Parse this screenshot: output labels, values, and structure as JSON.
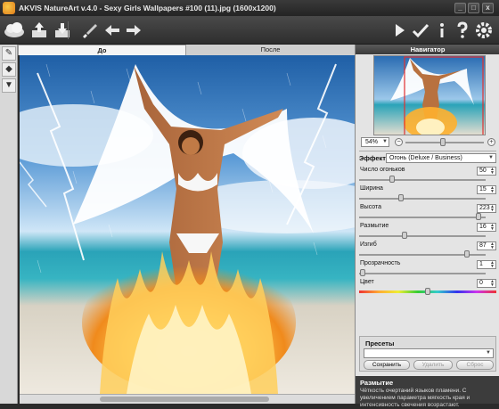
{
  "window": {
    "title": "AKVIS NatureArt v.4.0 - Sexy Girls Wallpapers #100 (11).jpg (1600x1200)",
    "minimize": "_",
    "maximize": "□",
    "close": "x"
  },
  "toolbar": {
    "icons": [
      "cloud-logo-icon",
      "open-file-icon",
      "save-file-icon",
      "brush-icon",
      "undo-icon",
      "redo-icon",
      "run-icon",
      "apply-icon",
      "info-icon",
      "help-icon",
      "settings-icon"
    ]
  },
  "tabs": {
    "before": "До",
    "after": "После"
  },
  "navigator": {
    "title": "Навигатор",
    "zoom": "54%",
    "zoom_out": "−",
    "zoom_in": "+",
    "zoom_level": 0.48
  },
  "effect": {
    "label": "Эффект:",
    "value": "Огонь (Deluxe / Business)"
  },
  "params": [
    {
      "label": "Число огоньков",
      "value": "50",
      "level": 0.25
    },
    {
      "label": "Ширина",
      "value": "15",
      "level": 0.32
    },
    {
      "label": "Высота",
      "value": "223",
      "level": 0.96
    },
    {
      "label": "Размытие",
      "value": "16",
      "level": 0.35
    },
    {
      "label": "Изгиб",
      "value": "87",
      "level": 0.87
    },
    {
      "label": "Прозрачность",
      "value": "1",
      "level": 0.01
    },
    {
      "label": "Цвет",
      "value": "0",
      "level": 0.5
    }
  ],
  "presets": {
    "title": "Пресеты",
    "value": "",
    "save": "Сохранить",
    "delete": "Удалить",
    "reset": "Сброс"
  },
  "help": {
    "title": "Размытие",
    "text": "Чёткость очертаний языков пламени. С увеличением параметра мягкость края и интенсивность свечения возрастают."
  },
  "colors": {
    "flame": "#ffb02e",
    "sky": "#2f72b9",
    "sea": "#2aa3b8"
  }
}
